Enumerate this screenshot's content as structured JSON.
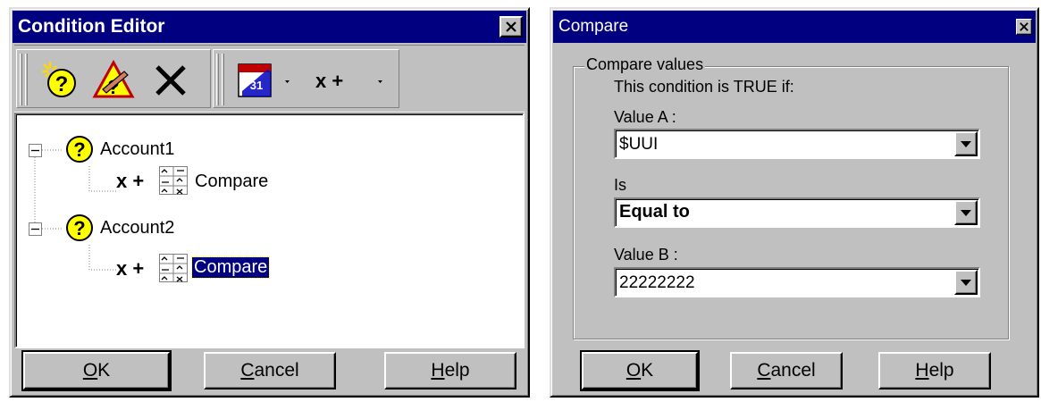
{
  "condition_editor": {
    "title": "Condition Editor",
    "toolbar": {
      "icons": [
        "new-condition-icon",
        "edit-condition-icon",
        "delete-icon",
        "calendar-icon",
        "compare-icon"
      ]
    },
    "tree": [
      {
        "label": "Account1",
        "children": [
          {
            "label": "Compare",
            "selected": false
          }
        ]
      },
      {
        "label": "Account2",
        "children": [
          {
            "label": "Compare",
            "selected": true
          }
        ]
      }
    ],
    "buttons": {
      "ok": {
        "accel": "O",
        "rest": "K"
      },
      "cancel": {
        "accel": "C",
        "rest": "ancel"
      },
      "help": {
        "accel": "H",
        "rest": "elp"
      }
    }
  },
  "compare_dialog": {
    "title": "Compare",
    "group_title": "Compare values",
    "description": "This condition is TRUE if:",
    "value_a": {
      "label": "Value A :",
      "value": "$UUI"
    },
    "operator": {
      "label": "Is",
      "value": "Equal to"
    },
    "value_b": {
      "label": "Value B :",
      "value": "22222222"
    },
    "buttons": {
      "ok": {
        "accel": "O",
        "rest": "K"
      },
      "cancel": {
        "accel": "C",
        "rest": "ancel"
      },
      "help": {
        "accel": "H",
        "rest": "elp"
      }
    }
  },
  "colors": {
    "title_bar": "#000080",
    "face": "#c0c0c0",
    "selection": "#000080",
    "question_icon": "#ffff00"
  }
}
